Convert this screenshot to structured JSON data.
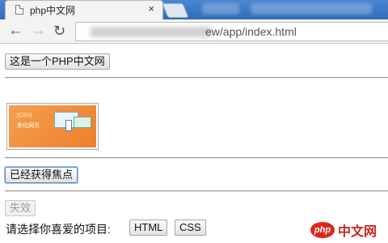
{
  "browser": {
    "tab": {
      "title": "php中文网",
      "close_glyph": "×"
    },
    "nav": {
      "back_glyph": "←",
      "forward_glyph": "→",
      "reload_glyph": "↻"
    },
    "address_bar": {
      "visible_url": "ew/app/index.html"
    }
  },
  "page": {
    "top_button_label": "这是一个PHP中文网",
    "image_banner": {
      "title": "[CSS]",
      "subtitle": "美化网页"
    },
    "focused_button_label": "已经获得焦点",
    "disabled_button_label": "失效",
    "prompt_label": "请选择你喜爱的项目:",
    "options": [
      "HTML",
      "CSS"
    ]
  },
  "watermark": {
    "logo_text": "php",
    "site_text": "中文网"
  },
  "colors": {
    "titlebar": "#3a78c6",
    "focus_ring": "#5b8fd6",
    "watermark_red": "#d9281b",
    "banner_orange": "#f08a34"
  }
}
